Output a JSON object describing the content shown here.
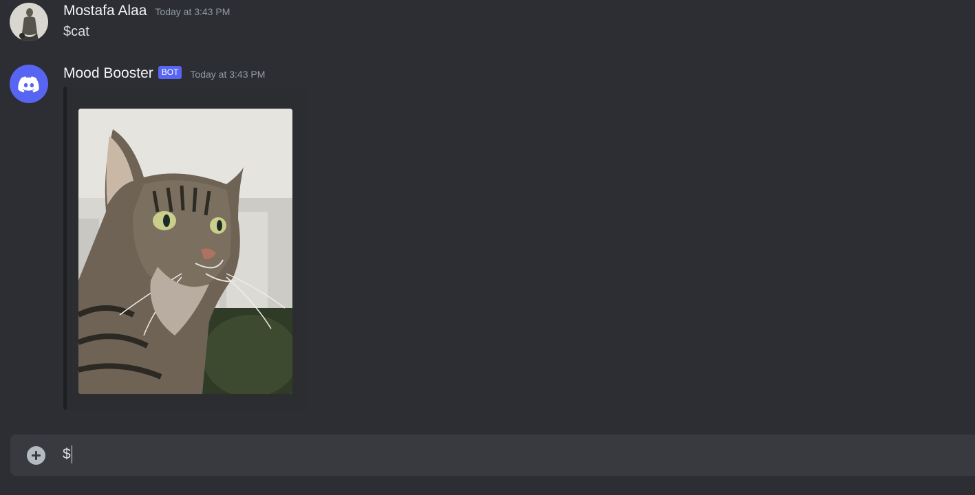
{
  "messages": [
    {
      "author": "Mostafa Alaa",
      "timestamp": "Today at 3:43 PM",
      "content": "$cat"
    },
    {
      "author": "Mood Booster",
      "bot_tag": "BOT",
      "timestamp": "Today at 3:43 PM"
    }
  ],
  "input": {
    "value": "$"
  },
  "colors": {
    "background": "#2c2e33",
    "blurple": "#5865f2",
    "input_bg": "#383a40"
  },
  "icons": [
    "discord-logo-icon",
    "add-attachment-icon"
  ]
}
